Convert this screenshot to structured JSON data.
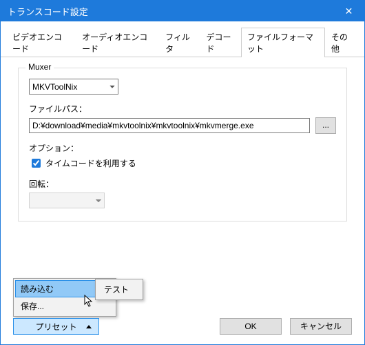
{
  "window": {
    "title": "トランスコード設定"
  },
  "tabs": {
    "items": [
      "ビデオエンコード",
      "オーディオエンコード",
      "フィルタ",
      "デコード",
      "ファイルフォーマット",
      "その他"
    ],
    "active_index": 4
  },
  "group": {
    "title": "Muxer",
    "muxer_select": "MKVToolNix",
    "filepath_label": "ファイルパス：",
    "filepath_value": "D:¥download¥media¥mkvtoolnix¥mkvtoolnix¥mkvmerge.exe",
    "browse_label": "...",
    "option_label": "オプション：",
    "timecode_checkbox_label": "タイムコードを利用する",
    "timecode_checked": true,
    "rotate_label": "回転："
  },
  "popup": {
    "load": "読み込む",
    "save": "保存...",
    "sub_test": "テスト"
  },
  "preset_button": "プリセット",
  "buttons": {
    "ok": "OK",
    "cancel": "キャンセル"
  }
}
